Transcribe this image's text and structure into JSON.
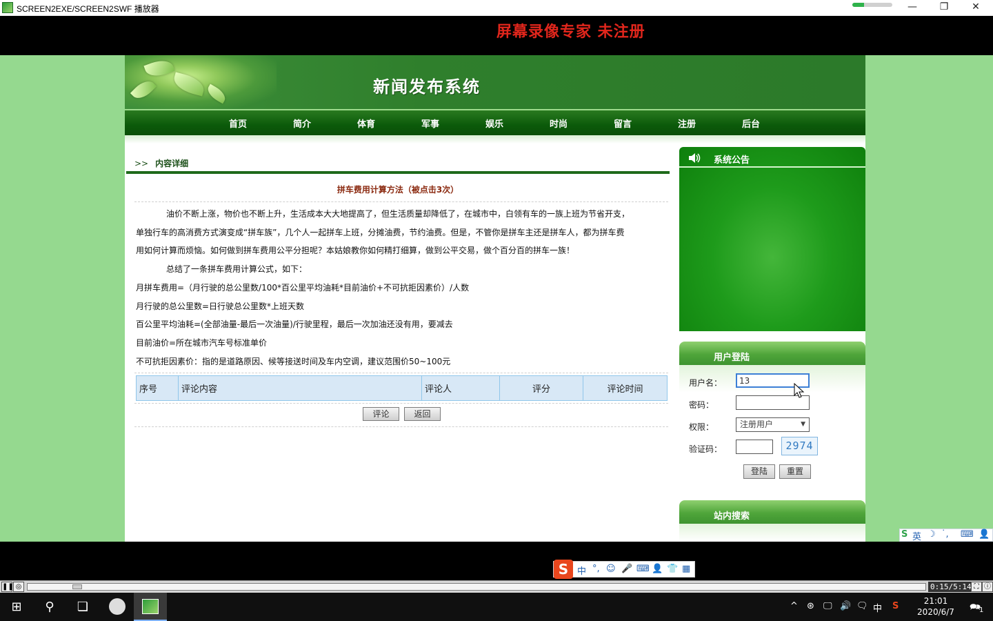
{
  "window": {
    "title": "SCREEN2EXE/SCREEN2SWF 播放器",
    "progress": 0.3,
    "minimize": "—",
    "restore": "❐",
    "close": "✕"
  },
  "watermark": "屏幕录像专家 未注册",
  "site": {
    "title": "新闻发布系统",
    "nav": [
      "首页",
      "简介",
      "体育",
      "军事",
      "娱乐",
      "时尚",
      "留言",
      "注册",
      "后台"
    ]
  },
  "article": {
    "crumb_arrows": ">>",
    "crumb": "内容详细",
    "title": "拼车费用计算方法（被点击3次）",
    "paragraphs": [
      "油价不断上涨，物价也不断上升，生活成本大大地提高了，但生活质量却降低了，在城市中，白领有车的一族上班为节省开支，",
      "单独行车的高消费方式演变成“拼车族”，几个人一起拼车上班，分摊油费，节约油费。但是，不管你是拼车主还是拼车人，都为拼车费",
      "用如何计算而烦恼。如何做到拼车费用公平分担呢？本姑娘教你如何精打细算，做到公平交易，做个百分百的拼车一族！",
      "总结了一条拼车费用计算公式，如下：",
      "月拼车费用=（月行驶的总公里数/100*百公里平均油耗*目前油价+不可抗拒因素价）/人数",
      "月行驶的总公里数=日行驶总公里数*上班天数",
      "百公里平均油耗=(全部油量-最后一次油量)/行驶里程，最后一次加油还没有用，要减去",
      "目前油价=所在城市汽车号标准单价",
      "不可抗拒因素价：指的是道路原因、候等接送时间及车内空调，建议范围价50~100元"
    ]
  },
  "comments": {
    "headers": [
      "序号",
      "评论内容",
      "评论人",
      "评分",
      "评论时间"
    ],
    "comment_button": "评论",
    "back_button": "返回"
  },
  "sidebar": {
    "notice_title": "系统公告",
    "login_title": "用户登陆",
    "username_label": "用户名：",
    "username_value": "13",
    "password_label": "密码：",
    "role_label": "权限：",
    "role_value": "注册用户",
    "captcha_label": "验证码：",
    "captcha_value": "2974",
    "login_button": "登陆",
    "reset_button": "重置",
    "search_title": "站内搜索"
  },
  "ime_mini": {
    "logo": "S",
    "lang": "英",
    "moon": "☽",
    "dot": "˙,",
    "kbd": "⌨",
    "user": "👤"
  },
  "ime_bar": {
    "logo": "S",
    "items": [
      "中",
      "°,",
      "☺",
      "🎤",
      "⌨",
      "👤",
      "👕",
      "▦"
    ]
  },
  "player": {
    "pause": "❚❚",
    "stop": "◎",
    "time": "0:15/5:14",
    "fit": "⛶",
    "info": "ⓘ",
    "progress": 0.05
  },
  "taskbar": {
    "start": "⊞",
    "search": "⚲",
    "taskview": "❏",
    "tray": [
      "^",
      "⊛",
      "🖵",
      "🔊",
      "🗨",
      "中",
      "S"
    ],
    "time": "21:01",
    "date": "2020/6/7",
    "notify": "🗪",
    "notify_count": "1"
  }
}
